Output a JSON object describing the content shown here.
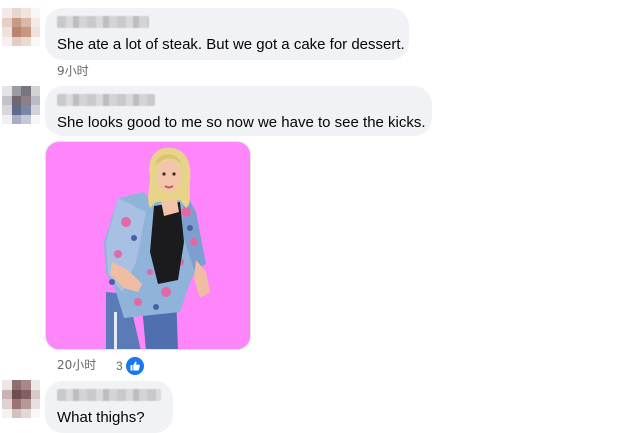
{
  "comments": [
    {
      "text": "She ate a lot of steak. But we got a cake for dessert.",
      "time": "9小时"
    },
    {
      "text": "She looks good to me so now we have to see the kicks.",
      "time": "20小时",
      "reaction_count": "3",
      "reaction_icon": "like-icon",
      "attachment": "gif-sticker-woman-dancing"
    },
    {
      "text": "What thighs?"
    }
  ],
  "colors": {
    "bubble": "#f0f2f5",
    "meta_text": "#65676b",
    "like": "#1877f2",
    "gif_background": "#ff85fb"
  }
}
